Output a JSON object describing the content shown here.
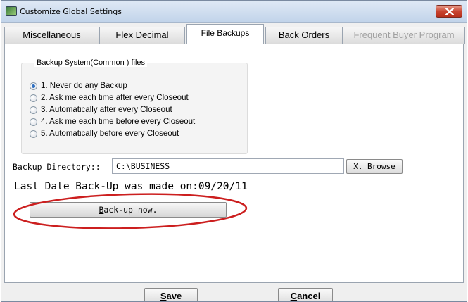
{
  "window": {
    "title": "Customize Global Settings"
  },
  "tabs": [
    {
      "label": "Miscellaneous",
      "accel": "M",
      "rest": "iscellaneous",
      "state": "normal"
    },
    {
      "label": "Flex Decimal",
      "pre": "Flex ",
      "accel": "D",
      "rest": "ecimal",
      "state": "normal"
    },
    {
      "label": "File Backups",
      "state": "active"
    },
    {
      "label": "Back Orders",
      "state": "normal"
    },
    {
      "label": "Frequent Buyer Program",
      "pre": "Frequent ",
      "accel": "B",
      "rest": "uyer Program",
      "state": "disabled"
    }
  ],
  "backup_group": {
    "title": "Backup System(Common ) files",
    "options": [
      {
        "num": "1",
        "text": ". Never do any Backup",
        "checked": true
      },
      {
        "num": "2",
        "text": ". Ask me each time after every Closeout",
        "checked": false
      },
      {
        "num": "3",
        "text": ". Automatically after every Closeout",
        "checked": false
      },
      {
        "num": "4",
        "text": ". Ask me each time before every Closeout",
        "checked": false
      },
      {
        "num": "5",
        "text": ". Automatically before every Closeout",
        "checked": false
      }
    ]
  },
  "directory": {
    "label": "Backup Directory::",
    "value": "C:\\BUSINESS",
    "browse_accel": "X",
    "browse_rest": ". Browse"
  },
  "last_backup": {
    "text": "Last Date Back-Up was made on:09/20/11"
  },
  "backup_now": {
    "accel": "B",
    "rest": "ack-up  now."
  },
  "footer": {
    "save_accel": "S",
    "save_rest": "ave",
    "cancel_accel": "C",
    "cancel_rest": "ancel"
  },
  "colors": {
    "annotation": "#cc1f1f",
    "radio_selected": "#2f6fc0",
    "close_button": "#c84430"
  },
  "icons": [
    "app-icon",
    "close-icon"
  ]
}
